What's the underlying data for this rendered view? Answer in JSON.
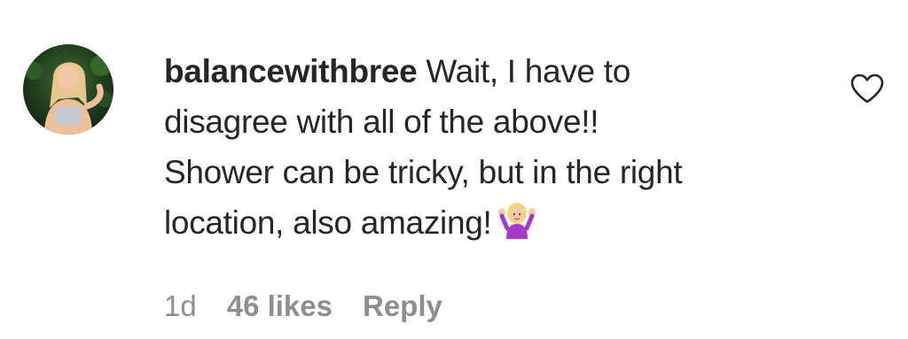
{
  "comment": {
    "username": "balancewithbree",
    "text_line1": "Wait, I have to",
    "text_line2": "disagree with all of the above!!",
    "text_line3": "Shower can be tricky, but in the right",
    "text_line4": "location, also amazing!",
    "emoji": "person-shrugging-emoji",
    "time": "1d",
    "likes": "46 likes",
    "reply_label": "Reply"
  },
  "icons": {
    "like": "heart-outline-icon"
  },
  "colors": {
    "text": "#262626",
    "meta": "#8e8e8e",
    "emoji_shirt": "#a43ac7",
    "emoji_hair": "#f3d77a"
  }
}
